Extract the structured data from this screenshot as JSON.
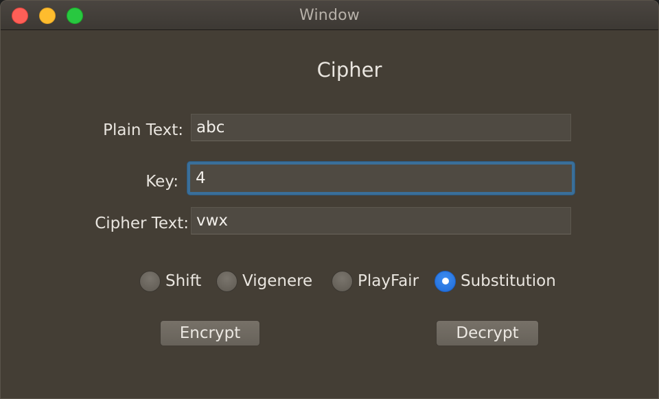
{
  "window": {
    "title": "Window",
    "controls": {
      "close": "#fe5f57",
      "minimize": "#febc2e",
      "zoom": "#28c840"
    }
  },
  "heading": "Cipher",
  "form": {
    "plain_text": {
      "label": "Plain Text:",
      "value": "abc"
    },
    "key": {
      "label": "Key:",
      "value": "4"
    },
    "cipher_text": {
      "label": "Cipher Text:",
      "value": "vwx"
    }
  },
  "methods": {
    "options": [
      "Shift",
      "Vigenere",
      "PlayFair",
      "Substitution"
    ],
    "selected": "Substitution"
  },
  "buttons": {
    "encrypt": "Encrypt",
    "decrypt": "Decrypt"
  },
  "colors": {
    "window_bg": "#443e35",
    "focus_ring": "#3a6f9a",
    "radio_selected": "#1f6bd8"
  }
}
